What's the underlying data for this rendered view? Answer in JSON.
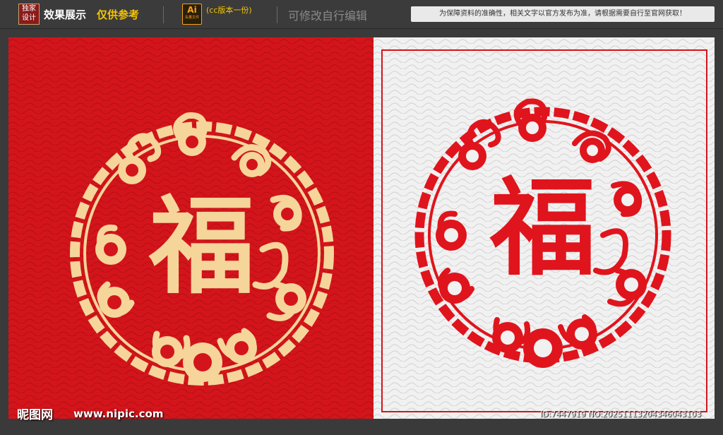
{
  "header": {
    "logo_text": "独家设计",
    "effect_label": "效果展示",
    "reference_label": "仅供参考",
    "file_icon": "Ai",
    "file_icon_sub": "矢量文件",
    "cc_version": "(cc版本一份)",
    "editable_label": "可修改自行编辑",
    "notice": "为保障资料的准确性，相关文字以官方发布为准，请根据需要自行至官网获取！"
  },
  "artwork": {
    "character": "福",
    "left_panel": {
      "background": "#d3151b",
      "motif_color": "#f6d59a"
    },
    "right_panel": {
      "background": "#f1f1f1",
      "motif_color": "#e0141c"
    }
  },
  "footer": {
    "site_logo": "昵图网",
    "site_url": "www.nipic.com",
    "image_id": "ID:7447919 NO:20251113204346043103"
  }
}
